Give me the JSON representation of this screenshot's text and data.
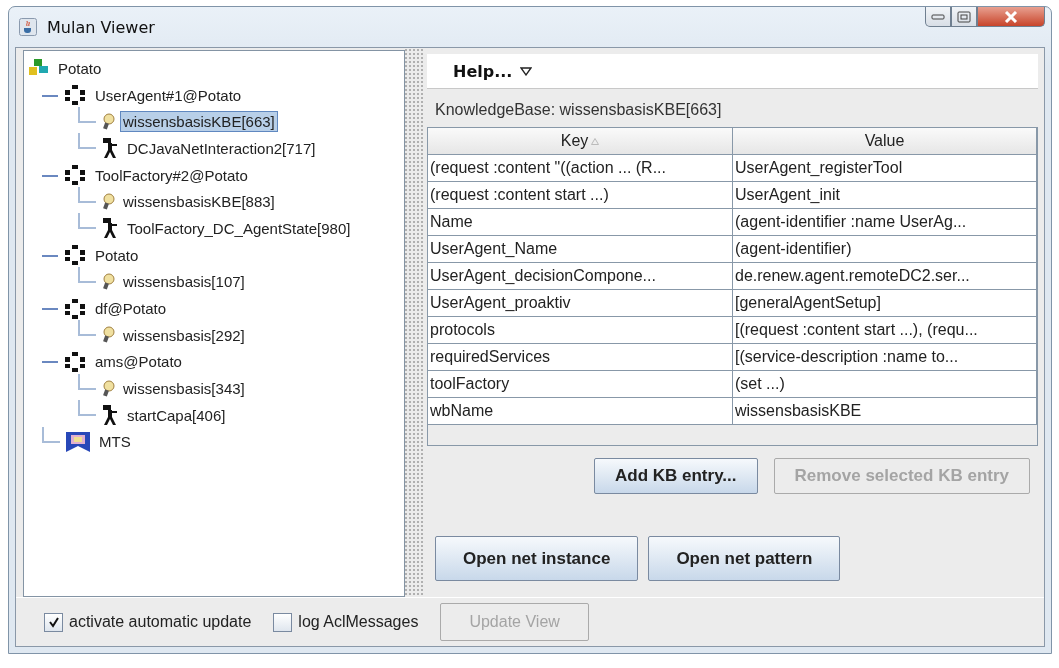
{
  "window": {
    "title": "Mulan Viewer"
  },
  "tree": [
    {
      "label": "Potato",
      "kind": "root",
      "selected": false,
      "children": [
        {
          "label": "UserAgent#1@Potato",
          "kind": "agent",
          "selected": false,
          "children": [
            {
              "label": "wissensbasisKBE[663]",
              "kind": "kb",
              "selected": true
            },
            {
              "label": "DCJavaNetInteraction2[717]",
              "kind": "dc",
              "selected": false
            }
          ]
        },
        {
          "label": "ToolFactory#2@Potato",
          "kind": "agent",
          "selected": false,
          "children": [
            {
              "label": "wissensbasisKBE[883]",
              "kind": "kb",
              "selected": false
            },
            {
              "label": "ToolFactory_DC_AgentState[980]",
              "kind": "dc",
              "selected": false
            }
          ]
        },
        {
          "label": "Potato",
          "kind": "agent",
          "selected": false,
          "children": [
            {
              "label": "wissensbasis[107]",
              "kind": "kb",
              "selected": false
            }
          ]
        },
        {
          "label": "df@Potato",
          "kind": "agent",
          "selected": false,
          "children": [
            {
              "label": "wissensbasis[292]",
              "kind": "kb",
              "selected": false
            }
          ]
        },
        {
          "label": "ams@Potato",
          "kind": "agent",
          "selected": false,
          "children": [
            {
              "label": "wissensbasis[343]",
              "kind": "kb",
              "selected": false
            },
            {
              "label": "startCapa[406]",
              "kind": "dc",
              "selected": false
            }
          ]
        },
        {
          "label": "MTS",
          "kind": "mts",
          "selected": false
        }
      ]
    }
  ],
  "menu": {
    "label": "Help..."
  },
  "kb_label": "KnowledgeBase: wissensbasisKBE[663]",
  "table": {
    "columns": [
      "Key",
      "Value"
    ],
    "rows": [
      [
        "(request :content \"((action ... (R...",
        "UserAgent_registerTool"
      ],
      [
        "(request :content start ...)",
        "UserAgent_init"
      ],
      [
        "Name",
        "(agent-identifier  :name UserAg..."
      ],
      [
        "UserAgent_Name",
        "(agent-identifier)"
      ],
      [
        "UserAgent_decisionCompone...",
        "de.renew.agent.remoteDC2.ser..."
      ],
      [
        "UserAgent_proaktiv",
        "[generalAgentSetup]"
      ],
      [
        "protocols",
        "[(request :content start ...), (requ..."
      ],
      [
        "requiredServices",
        "[(service-description   :name to..."
      ],
      [
        "toolFactory",
        "(set ...)"
      ],
      [
        "wbName",
        "wissensbasisKBE"
      ]
    ]
  },
  "kb_buttons": [
    {
      "label": "Add KB entry...",
      "disabled": false
    },
    {
      "label": "Remove selected KB entry",
      "disabled": true
    }
  ],
  "net_buttons": [
    {
      "label": "Open net instance",
      "disabled": false
    },
    {
      "label": "Open net pattern",
      "disabled": false
    }
  ],
  "options": [
    {
      "label": "activate automatic update",
      "checked": true
    },
    {
      "label": "log AclMessages",
      "checked": false
    }
  ],
  "update_button": {
    "label": "Update View",
    "disabled": true
  }
}
